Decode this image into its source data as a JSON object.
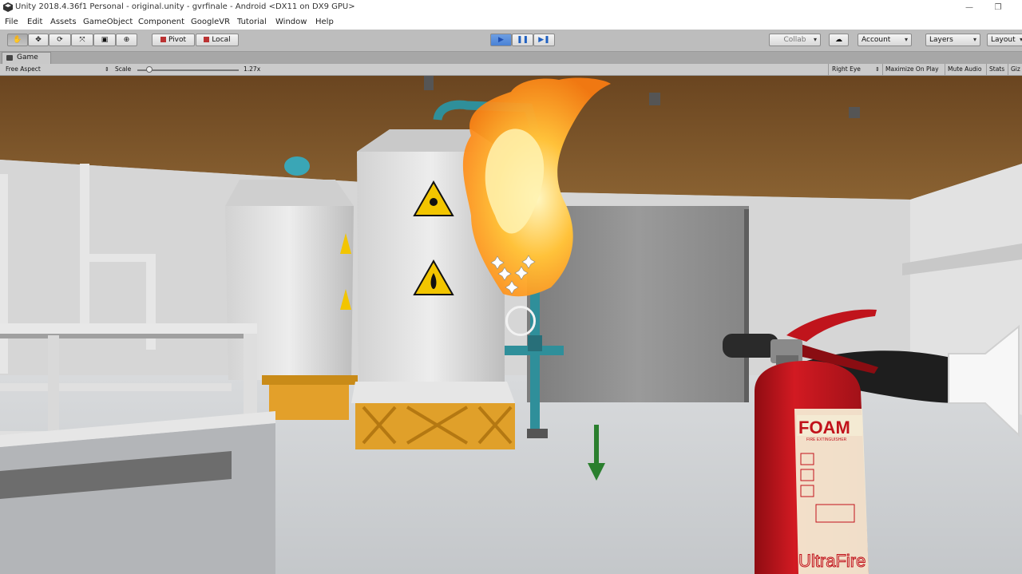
{
  "window": {
    "title": "Unity 2018.4.36f1 Personal - original.unity - gvrfinale - Android <DX11 on DX9 GPU>",
    "controls": [
      "—",
      "❐"
    ]
  },
  "menu": [
    "File",
    "Edit",
    "Assets",
    "GameObject",
    "Component",
    "GoogleVR",
    "Tutorial",
    "Window",
    "Help"
  ],
  "toolbar": {
    "tools": [
      "hand-tool",
      "move-tool",
      "rotate-tool",
      "scale-tool",
      "rect-tool",
      "transform-tool"
    ],
    "tool_glyphs": [
      "✋",
      "✥",
      "⟳",
      "⤧",
      "▣",
      "⊕"
    ],
    "pivot_label": "Pivot",
    "local_label": "Local",
    "play_glyphs": [
      "▶",
      "❚❚",
      "▶❚"
    ],
    "collab_label": "Collab",
    "cloud_glyph": "☁",
    "account_label": "Account",
    "layers_label": "Layers",
    "layout_label": "Layout"
  },
  "tab": {
    "label": "Game"
  },
  "game_controls": {
    "aspect": "Free Aspect",
    "scale_label": "Scale",
    "scale_value": "1.27x",
    "scale_fraction": 0.12,
    "eye": "Right Eye",
    "maximize": "Maximize On Play",
    "mute": "Mute Audio",
    "stats": "Stats",
    "gizmos": "Giz"
  },
  "scene": {
    "extinguisher_label": "FOAM",
    "extinguisher_sub": "FIRE EXTINGUISHER",
    "brand": "UltraFire",
    "colors": {
      "ceiling": "#7a5428",
      "floor": "#cfd2d5",
      "wall": "#d9d9d9",
      "extinguisher": "#c1121b",
      "pipe": "#2f8f9a",
      "stand": "#e09a1c",
      "fire": "#ff9a1a"
    }
  }
}
